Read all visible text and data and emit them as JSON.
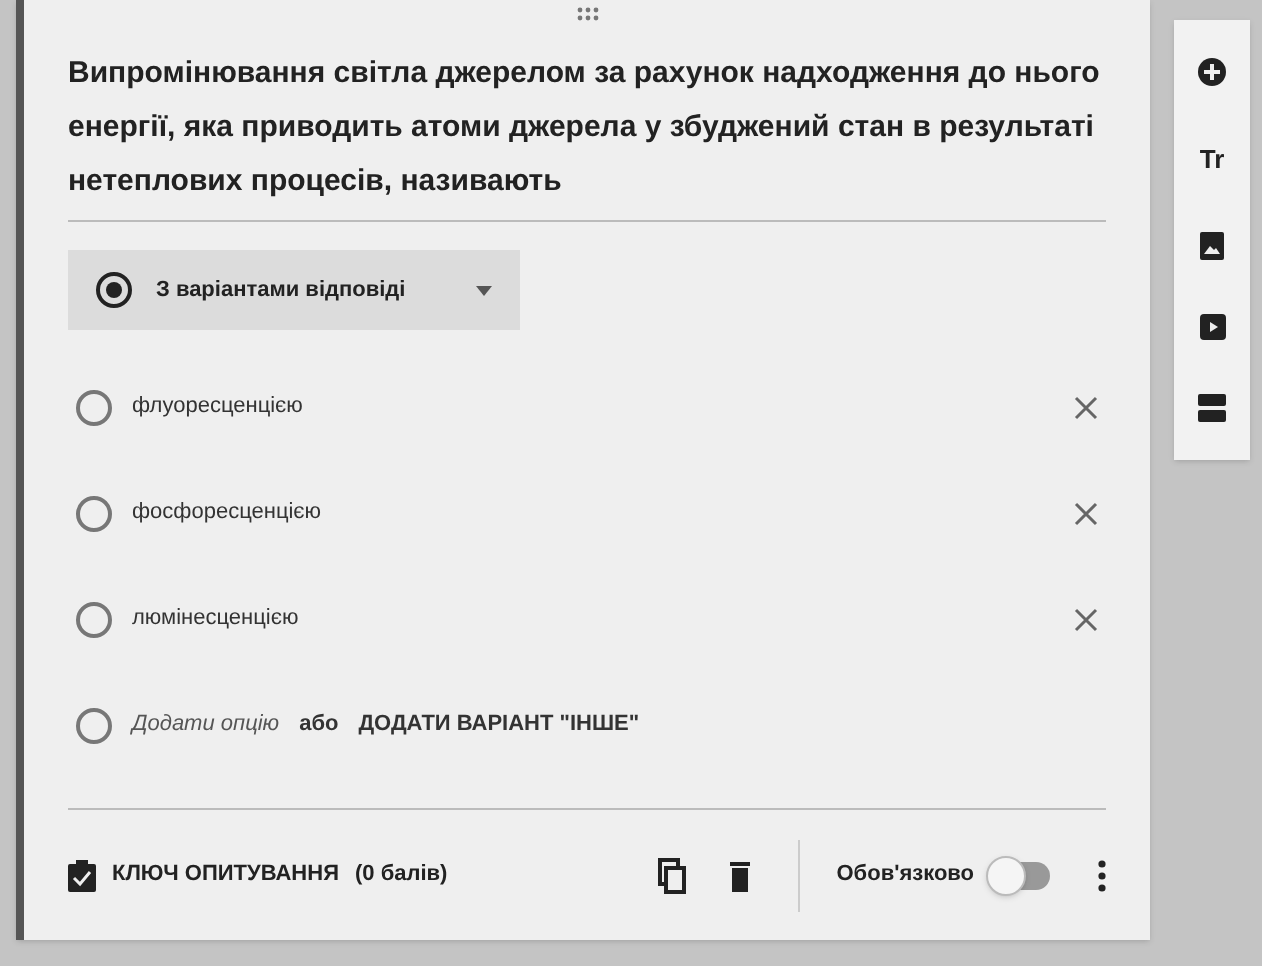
{
  "question": {
    "title": "Випромінювання світла джерелом за рахунок надходження до нього енергії, яка приводить атоми джерела у збуджений стан в результаті нетеплових процесів, називають"
  },
  "question_type": {
    "label": "З варіантами відповіді",
    "selected": true
  },
  "options": [
    {
      "label": "флуоресценцією",
      "selected": false
    },
    {
      "label": "фосфоресценцією",
      "selected": false
    },
    {
      "label": "люмінесценцією",
      "selected": false
    }
  ],
  "add_option": {
    "selected": false,
    "text": "Додати опцію",
    "link": "ДОДАТИ ВАРІАНТ \"ІНШЕ\"",
    "separator": "або"
  },
  "footer": {
    "answer_key": "КЛЮЧ ОПИТУВАННЯ",
    "points": "(0 балів)",
    "required_label": "Обов'язково",
    "required_on": false
  },
  "toolbar": {
    "text_button": "Tr"
  }
}
